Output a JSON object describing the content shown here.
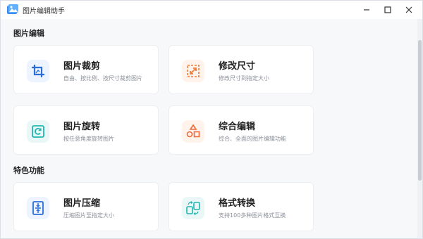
{
  "window": {
    "title": "图片编辑助手",
    "icon": "photo-app-icon",
    "controls": {
      "minimize": "minimize-icon",
      "maximize": "maximize-icon",
      "close": "close-icon"
    }
  },
  "sections": [
    {
      "title": "图片编辑",
      "cards": [
        {
          "title": "图片裁剪",
          "desc": "自由、按比例、按尺寸裁剪图片",
          "icon": "crop-icon",
          "color": "#2b6fd6",
          "bg": "#eef4ff"
        },
        {
          "title": "修改尺寸",
          "desc": "修改尺寸到指定大小",
          "icon": "resize-icon",
          "color": "#ef7d3c",
          "bg": "#fff3ec"
        },
        {
          "title": "图片旋转",
          "desc": "按任意角度旋转图片",
          "icon": "rotate-icon",
          "color": "#22b5b0",
          "bg": "#e9f8f7"
        },
        {
          "title": "综合编辑",
          "desc": "综合、全面的图片编辑功能",
          "icon": "shapes-icon",
          "color": "#ef6b3c",
          "bg": "#fff3ec"
        }
      ]
    },
    {
      "title": "特色功能",
      "cards": [
        {
          "title": "图片压缩",
          "desc": "压缩图片至指定大小",
          "icon": "compress-icon",
          "color": "#2b6fd6",
          "bg": "#eef4ff"
        },
        {
          "title": "格式转换",
          "desc": "支持100多种图片格式互换",
          "icon": "convert-icon",
          "color": "#22b5b0",
          "bg": "#e9f8f7"
        }
      ]
    }
  ]
}
